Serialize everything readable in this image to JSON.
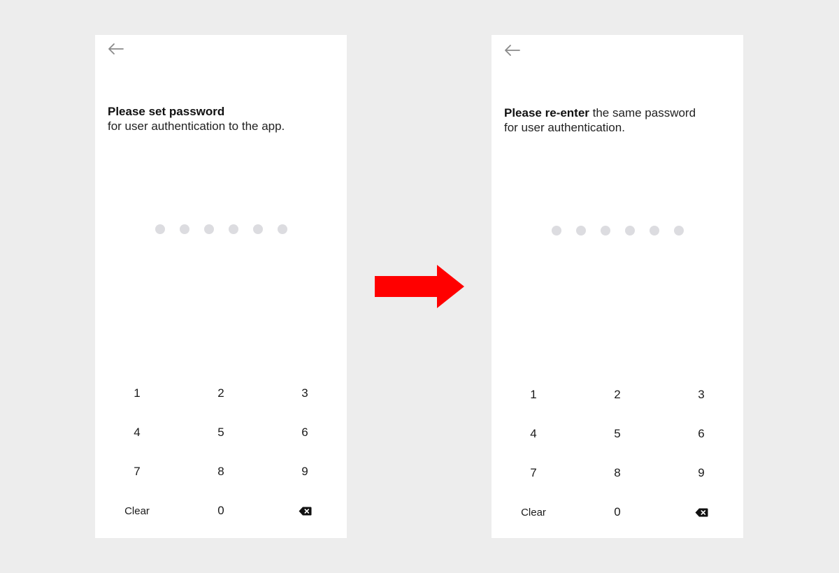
{
  "screens": [
    {
      "id": "set",
      "prompt_bold": "Please set password",
      "prompt_rest": "",
      "prompt_line2": "for user authentication to the app.",
      "pin_length": 6,
      "pin_filled": 0
    },
    {
      "id": "reenter",
      "prompt_bold": "Please re-enter",
      "prompt_rest": " the same password",
      "prompt_line2": "for user authentication.",
      "pin_length": 6,
      "pin_filled": 0
    }
  ],
  "keypad": {
    "k1": "1",
    "k2": "2",
    "k3": "3",
    "k4": "4",
    "k5": "5",
    "k6": "6",
    "k7": "7",
    "k8": "8",
    "k9": "9",
    "clear": "Clear",
    "k0": "0"
  },
  "icons": {
    "back": "arrow-left-icon",
    "backspace": "backspace-icon",
    "transition": "arrow-right-icon"
  },
  "colors": {
    "background": "#ededed",
    "screen": "#ffffff",
    "pin_dot_empty": "#dcdce0",
    "transition_arrow": "#ff0000",
    "text": "#1a1a1a"
  }
}
